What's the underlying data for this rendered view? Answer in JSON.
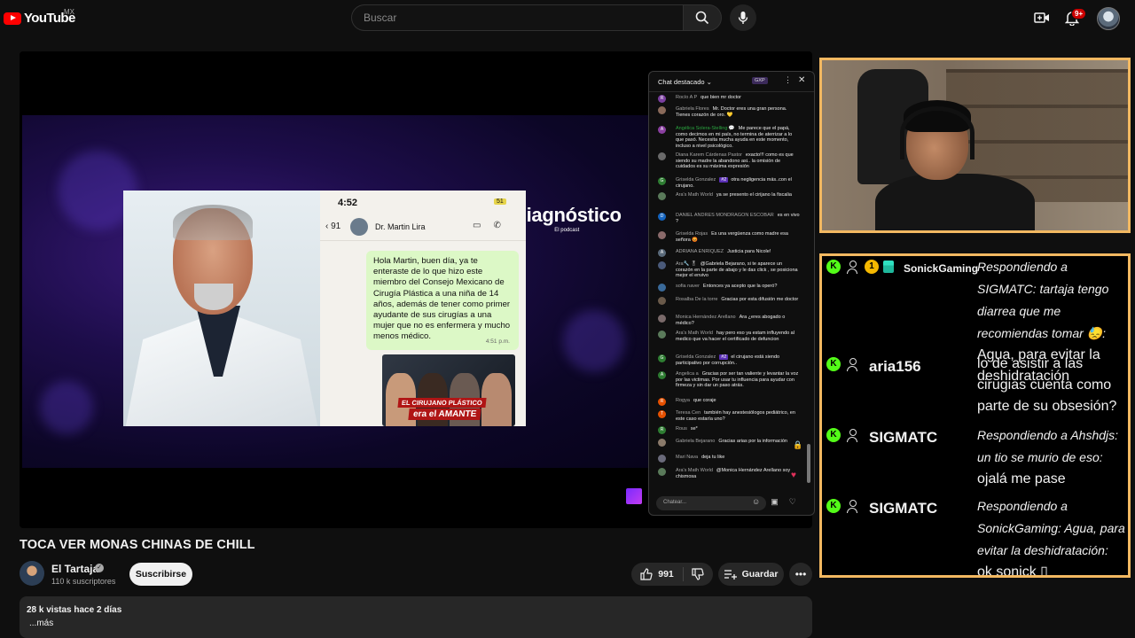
{
  "topbar": {
    "logo_text": "YouTube",
    "country": "MX",
    "search_placeholder": "Buscar",
    "notifications": "9+"
  },
  "video": {
    "title": "TOCA VER MONAS CHINAS DE CHILL",
    "channel": "El Tartaja",
    "subscribers": "110 k suscriptores",
    "subscribe_label": "Suscribirse",
    "likes": "991",
    "save_label": "Guardar",
    "views_date": "28 k vistas  hace 2 días",
    "more_label": "...más"
  },
  "frame": {
    "brand_title": "Diagnóstico",
    "brand_sub": "El podcast",
    "phone_time": "4:52",
    "phone_battery": "51",
    "back_count": "91",
    "contact_name": "Dr. Martin Lira",
    "bubble_text": "Hola Martin, buen día, ya te enteraste de lo que hizo este miembro del Consejo Mexicano de Cirugía Plástica a una niña de 14 años, además de tener como primer ayudante de sus cirugías a una mujer que no es enfermera y mucho menos médico.",
    "bubble_time": "4:51 p.m.",
    "news_line1": "EL CIRUJANO PLÁSTICO",
    "news_line2": "era el AMANTE"
  },
  "chat": {
    "title": "Chat destacado",
    "badge": "GXP",
    "input_placeholder": "Chatear...",
    "messages": [
      {
        "initial": "R",
        "color": "#7b3fa0",
        "author": "Rocío A P",
        "text": "que bien mr doctor",
        "mod": false
      },
      {
        "initial": "",
        "color": "#8a6a5a",
        "author": "Gabriela Flores",
        "text": "Mr. Doctor eres una gran persona. Tienes corazón de oro. 💛",
        "mod": false
      },
      {
        "initial": "A",
        "color": "#8a3fa0",
        "author": "Angélica Solera-Stelling 💬",
        "text": "Me parece que el papá, como decimos en mi país, no termina de aterrizar a lo que pasó. Necesita mucha ayuda en este momento, incluso a nivel psicológico.",
        "mod": true
      },
      {
        "initial": "",
        "color": "#6a6a6a",
        "author": "Diana Karem Cárdenas Pastor",
        "text": "exacto!!! como es que siendo su madre la abandono asi.. la omisión de cuidados es su máxima expresión",
        "mod": false
      },
      {
        "initial": "G",
        "color": "#2e7d32",
        "author": "Griselda Gonzalez",
        "tag": "#2",
        "text": "otra negligencia más..con el cirujano.",
        "mod": false
      },
      {
        "initial": "",
        "color": "#5a7a5a",
        "author": "Ara's Math World",
        "text": "ya se presento el cirijano la fiscalia",
        "mod": false
      },
      {
        "initial": "D",
        "color": "#1565c0",
        "author": "DANIEL ANDRES MONDRAGON ESCOBAR",
        "text": "es en vivo ?",
        "mod": false
      },
      {
        "initial": "",
        "color": "#8a6a6a",
        "author": "Griselda Rojas",
        "text": "Es una vergüenza como madre esa señora 😡",
        "mod": false
      },
      {
        "initial": "A",
        "color": "#5a6a7a",
        "author": "ADRIANA ENRIQUEZ",
        "text": "Justicia para Nicole!",
        "mod": false
      },
      {
        "initial": "",
        "color": "#4a5a7a",
        "author": "Ara🔧 🎖",
        "text": "@Gabriela Bejarano, si te aparece un corazón en la parte de abajo y le das click , se posiciona mejor el envivo",
        "mod": false
      },
      {
        "initial": "",
        "color": "#3a6a9a",
        "author": "sofia naver",
        "text": "Entonces ya acepto que la operó?",
        "mod": false
      },
      {
        "initial": "",
        "color": "#6a5a4a",
        "author": "Rosalba De la torre",
        "text": "Gracias por esta difusión me doctor",
        "mod": false
      },
      {
        "initial": "",
        "color": "#7a6a6a",
        "author": "Monica Hernández Arellano",
        "text": "Ara ¿eres abogado o médico?",
        "mod": false
      },
      {
        "initial": "",
        "color": "#5a7a5a",
        "author": "Ara's Math World",
        "text": "hay pero eso ya estam influyendo al medico que va hacer el certificado de defuncion",
        "mod": false
      },
      {
        "initial": "G",
        "color": "#2e7d32",
        "author": "Griselda Gonzalez",
        "tag": "#2",
        "text": "el cirujano está siendo participativo por corrupción..",
        "mod": false
      },
      {
        "initial": "A",
        "color": "#2e7d32",
        "author": "Angelica a",
        "text": "Gracias por ser tan valiente y levantar la voz por las victimas. Por usar tu influencia para ayudar con firmeza y sin dar un paso atrás.",
        "mod": false
      },
      {
        "initial": "R",
        "color": "#e65100",
        "author": "Rogya",
        "text": "que coraje",
        "mod": false
      },
      {
        "initial": "T",
        "color": "#e65100",
        "author": "Teresa Cen",
        "text": "también hay anestesiólogos pediátrico, en este caso estaría uno?",
        "mod": false
      },
      {
        "initial": "R",
        "color": "#2e7d32",
        "author": "Rous",
        "text": "se*",
        "mod": false
      },
      {
        "initial": "",
        "color": "#8a7a6a",
        "author": "Gabriela Bejarano",
        "text": "Gracias arias por la información",
        "mod": false
      },
      {
        "initial": "",
        "color": "#6a6a7a",
        "author": "Mari Nava",
        "text": "deja tu like",
        "mod": false
      },
      {
        "initial": "",
        "color": "#5a7a5a",
        "author": "Ara's Math World",
        "text": "@Monica Hernández Arellano soy chismosa",
        "mod": false
      }
    ]
  },
  "overlay": {
    "rows": [
      {
        "user": "SonickGaming",
        "reply": "Respondiendo a SIGMATC: tartaja tengo diarrea que me recomiendas tomar 😓:",
        "text": "Agua, para evitar la deshidratación",
        "extra_badges": true
      },
      {
        "user": "aria156",
        "reply": "",
        "text": "lo de asistir a las cirugias cuenta como parte de su obsesión?",
        "extra_badges": false
      },
      {
        "user": "SIGMATC",
        "reply": "Respondiendo a Ahshdjs: un tio se murio de eso:",
        "text": "ojalá me pase",
        "extra_badges": false
      },
      {
        "user": "SIGMATC",
        "reply": "Respondiendo a SonickGaming: Agua, para evitar la deshidratación:",
        "text": "ok sonick ▯",
        "extra_badges": false
      }
    ]
  },
  "colors": {
    "accent_red": "#ff0000",
    "overlay_border": "#f2b861",
    "kick_green": "#53fc18"
  }
}
